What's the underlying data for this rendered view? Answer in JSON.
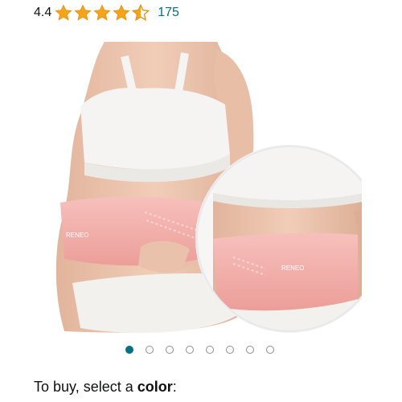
{
  "rating": {
    "value": "4.4",
    "stars": 4.5,
    "review_count": "175",
    "star_color": "#f7a41d"
  },
  "product": {
    "brand_on_belt": "RENEO",
    "belt_color": "#f4b1ad",
    "icons": [
      "star-icon",
      "half-star-icon"
    ]
  },
  "gallery": {
    "dot_count": 8,
    "active_index": 0,
    "active_color": "#007185"
  },
  "buy": {
    "prefix": "To buy, select a ",
    "emphasis": "color",
    "suffix": ":"
  }
}
